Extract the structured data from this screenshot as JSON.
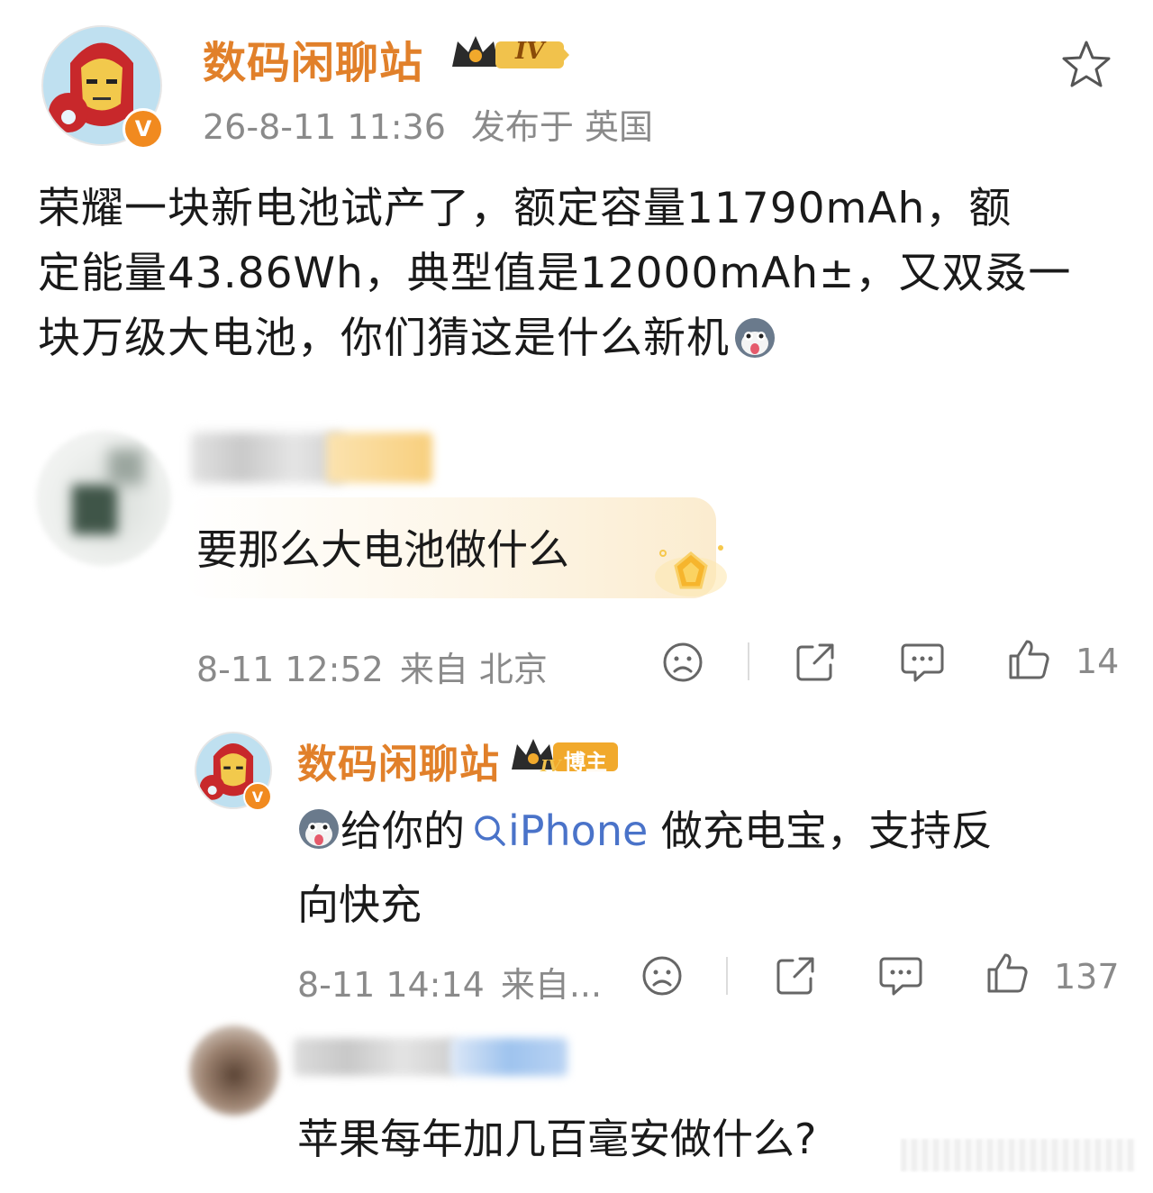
{
  "post": {
    "author_name": "数码闲聊站",
    "level_badge": "IV",
    "timestamp": "26-8-11 11:36",
    "published_from": "发布于 英国",
    "body_lines": [
      "荣耀一块新电池试产了，额定容量11790mAh，额",
      "定能量43.86Wh，典型值是12000mAh±，又双叒一",
      "块万级大电池，你们猜这是什么新机"
    ],
    "icons": [
      "star-icon",
      "husky-emoji-icon",
      "verified-v-icon"
    ]
  },
  "comments": [
    {
      "text": "要那么大电池做什么",
      "time": "8-11 12:52",
      "location": "来自 北京",
      "likes": "14"
    }
  ],
  "reply": {
    "author_name": "数码闲聊站",
    "level_badge": "IV",
    "role_badge": "博主",
    "text_before_link": "给你的",
    "link_text": "iPhone",
    "text_after_link_line1": " 做充电宝，支持反",
    "text_line2": "向快充",
    "time": "8-11 14:14",
    "location": "来自...",
    "likes": "137"
  },
  "second_comment": {
    "text": "苹果每年加几百毫安做什么?"
  },
  "colors": {
    "author_orange": "#e1802a",
    "link_blue": "#4a73c9",
    "meta_gray": "#8a8a8a",
    "badge_gold": "#f1a92c"
  }
}
